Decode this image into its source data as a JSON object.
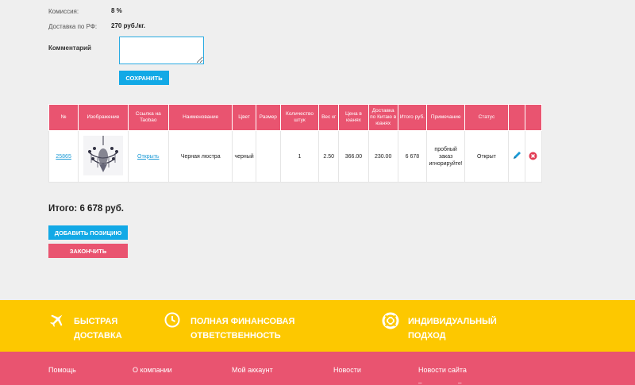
{
  "form": {
    "commission_label": "Комиссия:",
    "commission_value": "8 %",
    "delivery_label": "Доставка по РФ:",
    "delivery_value": "270 руб./кг.",
    "comment_label": "Комментарий",
    "comment_value": "",
    "save_label": "СОХРАНИТЬ"
  },
  "table": {
    "headers": [
      "№",
      "Изображение",
      "Ссылка на Taobao",
      "Наименование",
      "Цвет",
      "Размер",
      "Количество штук",
      "Вес кг",
      "Цена в юанях",
      "Доставка по Китаю в юанях",
      "Итого руб.",
      "Примечание",
      "Статус",
      "",
      ""
    ],
    "rows": [
      {
        "id": "25865",
        "image_alt": "chandelier",
        "link": "Открыть",
        "name": "Черная люстра",
        "color": "черный",
        "size": "",
        "qty": "1",
        "weight": "2.50",
        "price_cny": "366.00",
        "delivery_cny": "230.00",
        "total_rub": "6 678",
        "note": "пробный заказ игнорируйте!",
        "status": "Открыт",
        "edit_icon": "pencil-icon",
        "delete_icon": "delete-icon"
      }
    ]
  },
  "summary": {
    "total": "Итого: 6 678 руб."
  },
  "actions": {
    "add_position": "ДОБАВИТЬ ПОЗИЦИЮ",
    "finish": "ЗАКОНЧИТЬ"
  },
  "features": [
    {
      "icon": "airplane-icon",
      "line1": "БЫСТРАЯ",
      "line2": "ДОСТАВКА"
    },
    {
      "icon": "clock-icon",
      "line1": "ПОЛНАЯ ФИНАНСОВАЯ",
      "line2": "ОТВЕТСТВЕННОСТЬ"
    },
    {
      "icon": "lifebuoy-icon",
      "line1": "ИНДИВИДУАЛЬНЫЙ",
      "line2": "ПОДХОД"
    }
  ],
  "footer": {
    "menu": [
      "Помощь",
      "О компании",
      "Мой аккаунт",
      "Новости",
      "Новости сайта"
    ]
  },
  "colors": {
    "accent_pink": "#e95470",
    "accent_blue": "#12a9e6",
    "band_yellow": "#fdc800"
  }
}
